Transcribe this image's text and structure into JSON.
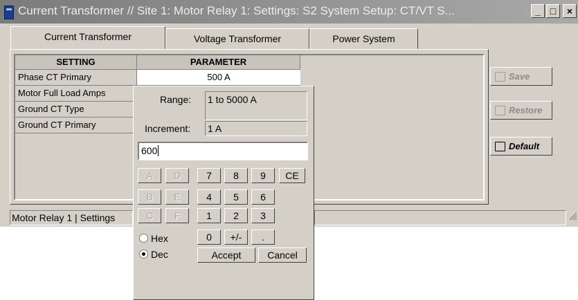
{
  "window": {
    "title": "Current Transformer // Site 1: Motor Relay 1: Settings: S2 System Setup: CT/VT S..."
  },
  "titlebar_buttons": {
    "minimize": "_",
    "maximize": "□",
    "close": "×"
  },
  "tabs": [
    {
      "label": "Current Transformer"
    },
    {
      "label": "Voltage Transformer"
    },
    {
      "label": "Power System"
    }
  ],
  "grid": {
    "headers": {
      "setting": "SETTING",
      "parameter": "PARAMETER"
    },
    "rows": [
      {
        "setting": "Phase CT Primary",
        "parameter": "500 A"
      },
      {
        "setting": "Motor Full Load Amps",
        "parameter": ""
      },
      {
        "setting": "Ground CT Type",
        "parameter": ""
      },
      {
        "setting": "Ground CT Primary",
        "parameter": ""
      }
    ]
  },
  "side_buttons": {
    "save": "Save",
    "restore": "Restore",
    "default": "Default"
  },
  "status": {
    "device": "Motor Relay 1",
    "section": "Settings"
  },
  "popup": {
    "range_label": "Range:",
    "range_value": "1 to 5000 A",
    "increment_label": "Increment:",
    "increment_value": "1 A",
    "entry_value": "600",
    "hex_keys": [
      "A",
      "D",
      "B",
      "E",
      "C",
      "F"
    ],
    "digit_keys": [
      "7",
      "8",
      "9",
      "CE",
      "4",
      "5",
      "6",
      "1",
      "2",
      "3",
      "0",
      "+/-",
      "."
    ],
    "radio": {
      "hex": "Hex",
      "dec": "Dec",
      "selected": "Dec"
    },
    "accept": "Accept",
    "cancel": "Cancel"
  }
}
